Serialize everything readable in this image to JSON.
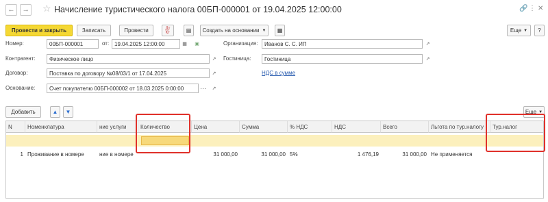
{
  "header": {
    "title": "Начисление туристического налога 00БП-000001 от 19.04.2025 12:00:00",
    "nav_back_icon": "arrow-left-icon",
    "nav_forward_icon": "arrow-right-icon"
  },
  "toolbar": {
    "post_close": "Провести и закрыть",
    "save": "Записать",
    "post": "Провести",
    "create_based": "Создать на основании",
    "more": "Еще"
  },
  "form": {
    "number_label": "Номер:",
    "number_value": "00БП-000001",
    "date_label": "от:",
    "date_value": "19.04.2025 12:00:00",
    "org_label": "Организация:",
    "org_value": "Иванов С. С. ИП",
    "counterparty_label": "Контрагент:",
    "counterparty_value": "Физическое лицо",
    "hotel_label": "Гостиница:",
    "hotel_value": "Гостиница",
    "contract_label": "Договор:",
    "contract_value": "Поставка по договору №08/03/1 от 17.04.2025",
    "vat_link": "НДС в сумме",
    "basis_label": "Основание:",
    "basis_value": "Счет покупателю 00БП-000002 от 18.03.2025 0:00:00"
  },
  "table_toolbar": {
    "add": "Добавить",
    "more": "Еще"
  },
  "table": {
    "columns": [
      "N",
      "Номенклатура",
      "ние услуги",
      "Количество",
      "Цена",
      "Сумма",
      "% НДС",
      "НДС",
      "Всего",
      "Льгота по тур.налогу",
      "Тур.налог"
    ],
    "rows": [
      [
        "1",
        "Проживание в номере",
        "ние в номере",
        "",
        "31 000,00",
        "31 000,00",
        "5%",
        "1 476,19",
        "31 000,00",
        "Не применяется",
        ""
      ]
    ]
  }
}
